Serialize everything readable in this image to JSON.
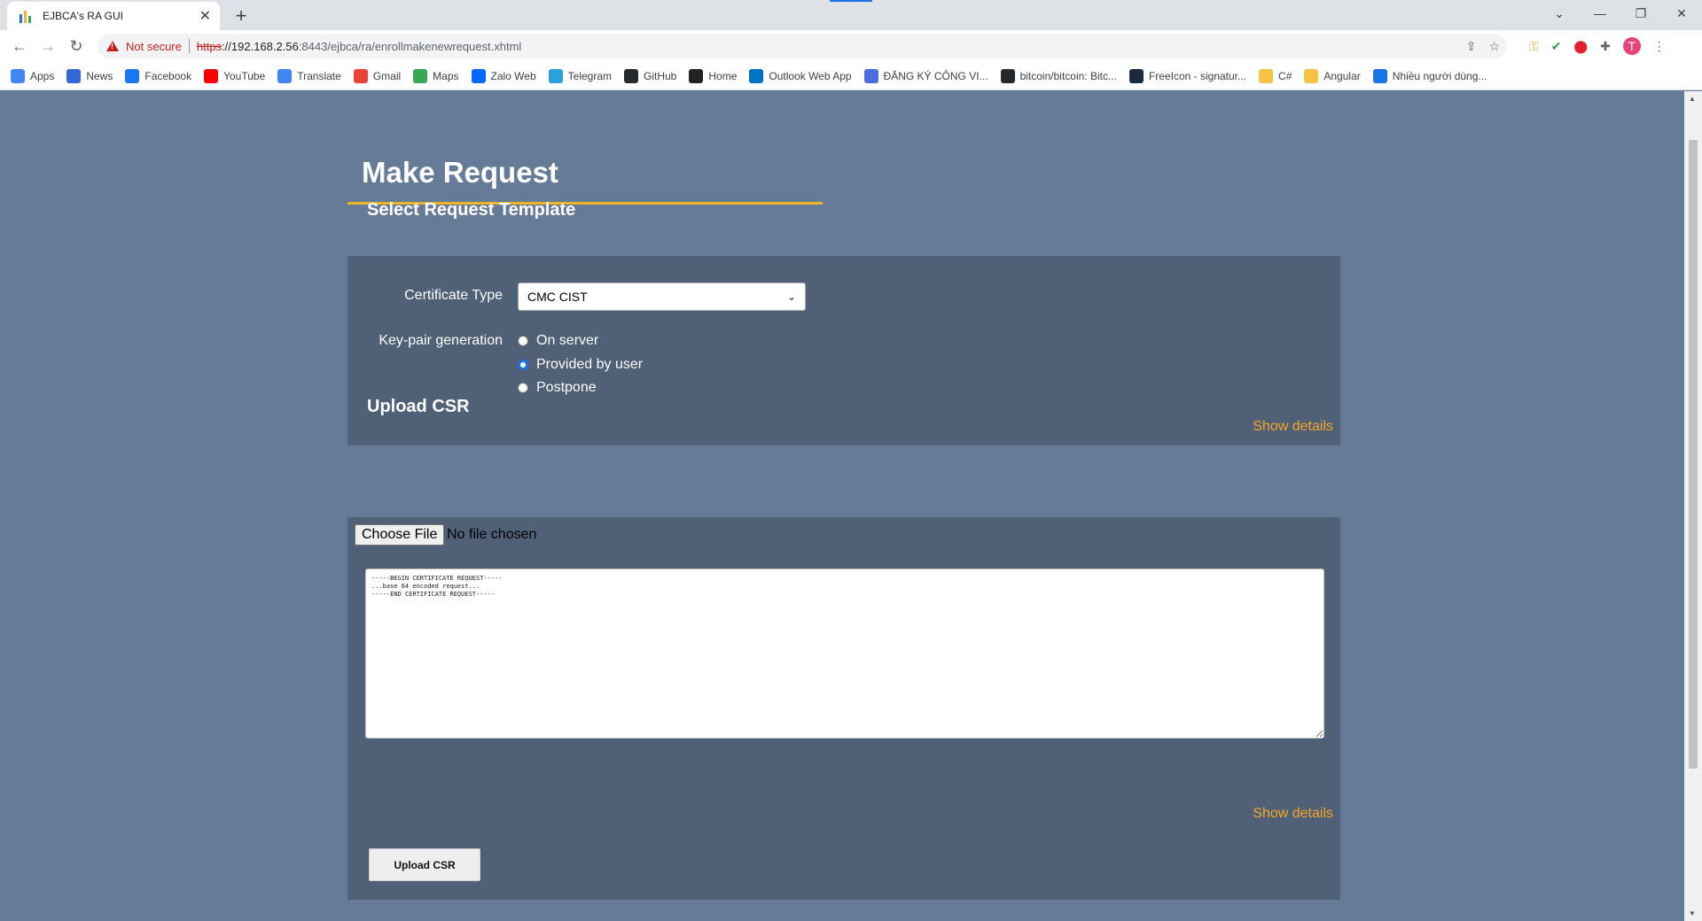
{
  "browser": {
    "tab_title": "EJBCA's RA GUI",
    "tab_close": "✕",
    "new_tab": "+",
    "security_label": "Not secure",
    "url_scheme": "https",
    "url_host": "://192.168.2.56",
    "url_path": ":8443/ejbca/ra/enrollmakenewrequest.xhtml",
    "profile_initial": "T"
  },
  "bookmarks": [
    {
      "label": "Apps",
      "color": "#4285f4"
    },
    {
      "label": "News",
      "color": "#3367d6"
    },
    {
      "label": "Facebook",
      "color": "#1877f2"
    },
    {
      "label": "YouTube",
      "color": "#ff0000"
    },
    {
      "label": "Translate",
      "color": "#4285f4"
    },
    {
      "label": "Gmail",
      "color": "#ea4335"
    },
    {
      "label": "Maps",
      "color": "#34a853"
    },
    {
      "label": "Zalo Web",
      "color": "#0068ff"
    },
    {
      "label": "Telegram",
      "color": "#2aa1da"
    },
    {
      "label": "GitHub",
      "color": "#24292e"
    },
    {
      "label": "Home",
      "color": "#222222"
    },
    {
      "label": "Outlook Web App",
      "color": "#0072c6"
    },
    {
      "label": "ĐĂNG KÝ CÔNG VI...",
      "color": "#4a6ee0"
    },
    {
      "label": "bitcoin/bitcoin: Bitc...",
      "color": "#24292e"
    },
    {
      "label": "FreeIcon - signatur...",
      "color": "#1b2a3a"
    },
    {
      "label": "C#",
      "color": "#f6c244"
    },
    {
      "label": "Angular",
      "color": "#f6c244"
    },
    {
      "label": "Nhiều người dùng...",
      "color": "#1a73e8"
    }
  ],
  "page": {
    "title": "Make Request",
    "template_section": {
      "heading": "Select Request Template",
      "certificate_type_label": "Certificate Type",
      "certificate_type_value": "CMC CIST",
      "keypair_label": "Key-pair generation",
      "keypair_options": [
        "On server",
        "Provided by user",
        "Postpone"
      ],
      "keypair_selected": "Provided by user",
      "show_details": "Show details"
    },
    "csr_section": {
      "heading": "Upload CSR",
      "choose_file_label": "Choose File",
      "file_status": "No file chosen",
      "csr_placeholder": "-----BEGIN CERTIFICATE REQUEST-----\n...base 64 encoded request...\n-----END CERTIFICATE REQUEST-----",
      "show_details": "Show details",
      "upload_button": "Upload CSR"
    }
  },
  "colors": {
    "page_bg": "#667b98",
    "panel_bg": "#4f6077",
    "accent": "#f0b429",
    "link": "#f5a623"
  }
}
